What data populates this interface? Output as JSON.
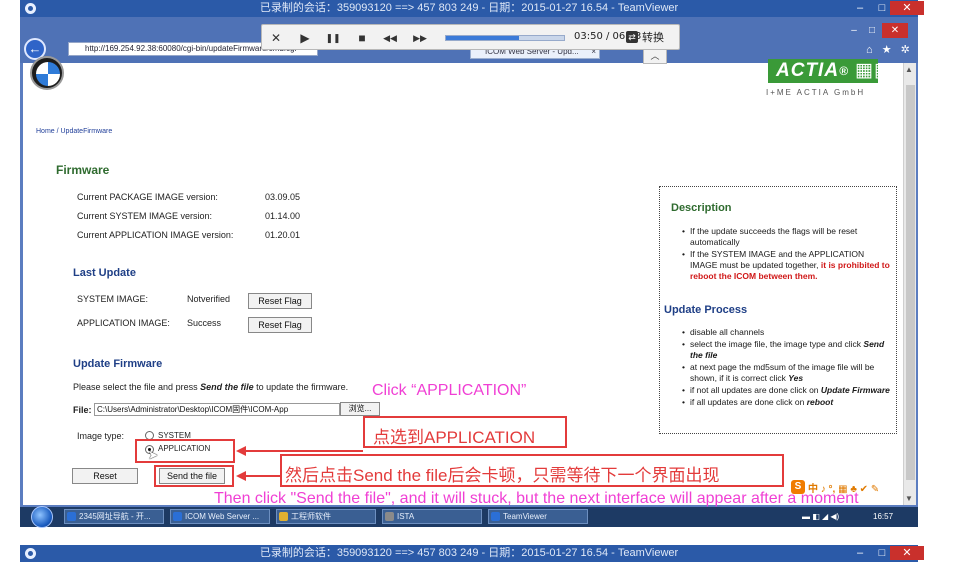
{
  "teamviewer": {
    "title": "已录制的会话：359093120 ==> 457 803 249 - 日期：2015-01-27 16.54 - TeamViewer",
    "minimize": "–",
    "maximize": "□",
    "close": "✕"
  },
  "browser": {
    "url": "http://169.254.92.38:60080/cgi-bin/updateFirmware/cmd.cgi",
    "tab_title": "ICOM Web Server - Upd...",
    "tab_close": "×",
    "back": "←",
    "top_icons": "⌂ ★ ✲"
  },
  "player": {
    "stop": "✕",
    "play": "▶",
    "pause": "❚❚",
    "square": "■",
    "rewind": "◀◀",
    "forward": "▶▶",
    "time": "03:50 / 06:13",
    "progress": 0.617,
    "convert": "转换",
    "dropdown": "︿"
  },
  "webpage": {
    "brand": "ACTIA",
    "brand_sub": "I+ME ACTIA GmbH",
    "breadcrumb": "Home / UpdateFirmware",
    "firmware": {
      "heading": "Firmware",
      "rows": [
        {
          "label": "Current PACKAGE IMAGE version:",
          "value": "03.09.05"
        },
        {
          "label": "Current SYSTEM IMAGE version:",
          "value": "01.14.00"
        },
        {
          "label": "Current APPLICATION IMAGE version:",
          "value": "01.20.01"
        }
      ]
    },
    "last_update": {
      "heading": "Last Update",
      "system_label": "SYSTEM IMAGE:",
      "system_status": "Notverified",
      "application_label": "APPLICATION IMAGE:",
      "application_status": "Success",
      "reset_flag": "Reset Flag"
    },
    "update_firmware": {
      "heading": "Update Firmware",
      "instruction_pre": "Please select the file and press ",
      "instruction_bold": "Send the file",
      "instruction_post": " to update the firmware.",
      "file_label": "File:",
      "file_value": "C:\\Users\\Administrator\\Desktop\\ICOM固件\\ICOM-App",
      "browse": "浏览...",
      "image_type_label": "Image type:",
      "option_system": "SYSTEM",
      "option_application": "APPLICATION",
      "reset": "Reset",
      "send": "Send the file"
    },
    "description": {
      "heading": "Description",
      "item1": "If the update succeeds the flags will be reset automatically",
      "item2_pre": "If the SYSTEM IMAGE and the APPLICATION IMAGE must be updated together, ",
      "item2_red": "it is prohibited to reboot the ICOM between them.",
      "process_heading": "Update Process",
      "p1": "disable all channels",
      "p2_pre": "select the image file, the image type and click ",
      "p2_bold": "Send the file",
      "p3_pre": "at next page the md5sum of the image file will be shown, if it is correct click ",
      "p3_bold": "Yes",
      "p4_pre": "if not all updates are done click on ",
      "p4_bold": "Update Firmware",
      "p5_pre": "if all updates are done click on ",
      "p5_bold": "reboot"
    }
  },
  "annotations": {
    "click_application": "Click  “APPLICATION”",
    "select_application_cn": "点选到APPLICATION",
    "send_file_cn": "然后点击Send the file后会卡顿，只需等待下一个界面出现",
    "send_file_en": "Then click \"Send the file\", and it will stuck, but the next interface will appear after a moment"
  },
  "ime": {
    "label": "S",
    "text": "中 ♪ °, ▦ ♣ ✔ ✎"
  },
  "taskbar": {
    "tasks": [
      {
        "label": "2345网址导航 - 开...",
        "color": "#2b6fd6"
      },
      {
        "label": "ICOM Web Server ...",
        "color": "#2b6fd6"
      },
      {
        "label": "工程师软件",
        "color": "#e0b030"
      },
      {
        "label": "ISTA",
        "color": "#8a8a8a"
      },
      {
        "label": "TeamViewer",
        "color": "#2b6fd6"
      }
    ],
    "tray_icons": "▬ ◧ ◢ ◀)",
    "clock": "16:57"
  }
}
